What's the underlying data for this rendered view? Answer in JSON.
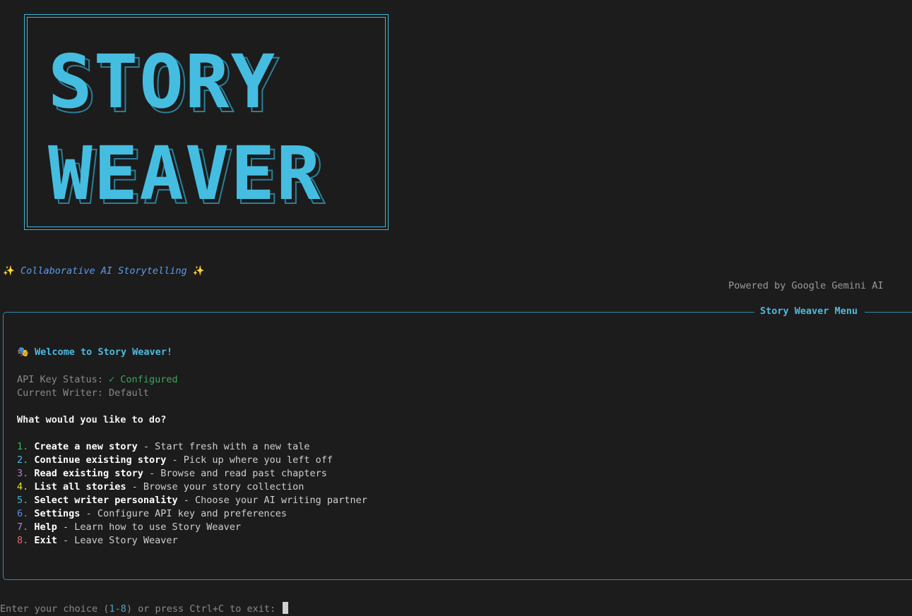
{
  "logo": {
    "line1": "STORY",
    "line2": "WEAVER",
    "color": "#3fb6d9"
  },
  "tagline": {
    "spark_icon": "✨",
    "text": "Collaborative AI Storytelling"
  },
  "powered_by": "Powered by Google Gemini AI",
  "menu_panel": {
    "title": "Story Weaver Menu",
    "welcome_icon": "🎭",
    "welcome": "Welcome to Story Weaver!",
    "api_key_label": "API Key Status: ",
    "api_key_value": "✓ Configured",
    "current_writer": "Current Writer: Default",
    "question": "What would you like to do?",
    "items": [
      {
        "num": "1.",
        "name": "Create a new story",
        "desc": " - Start fresh with a new tale",
        "color": "#3fb950"
      },
      {
        "num": "2.",
        "name": "Continue existing story",
        "desc": " - Pick up where you left off",
        "color": "#4fb9e0"
      },
      {
        "num": "3.",
        "name": "Read existing story",
        "desc": " - Browse and read past chapters",
        "color": "#c678dd"
      },
      {
        "num": "4.",
        "name": "List all stories",
        "desc": " - Browse your story collection",
        "color": "#e5e510"
      },
      {
        "num": "5.",
        "name": "Select writer personality",
        "desc": " - Choose your AI writing partner",
        "color": "#3fb6d9"
      },
      {
        "num": "6.",
        "name": "Settings",
        "desc": " - Configure API key and preferences",
        "color": "#5b8df0"
      },
      {
        "num": "7.",
        "name": "Help",
        "desc": " - Learn how to use Story Weaver",
        "color": "#b77fe0"
      },
      {
        "num": "8.",
        "name": "Exit",
        "desc": " - Leave Story Weaver",
        "color": "#e06c75"
      }
    ]
  },
  "footer": {
    "before": "Enter your choice (",
    "range": "1-8",
    "after": ") or press Ctrl+C to exit: "
  }
}
